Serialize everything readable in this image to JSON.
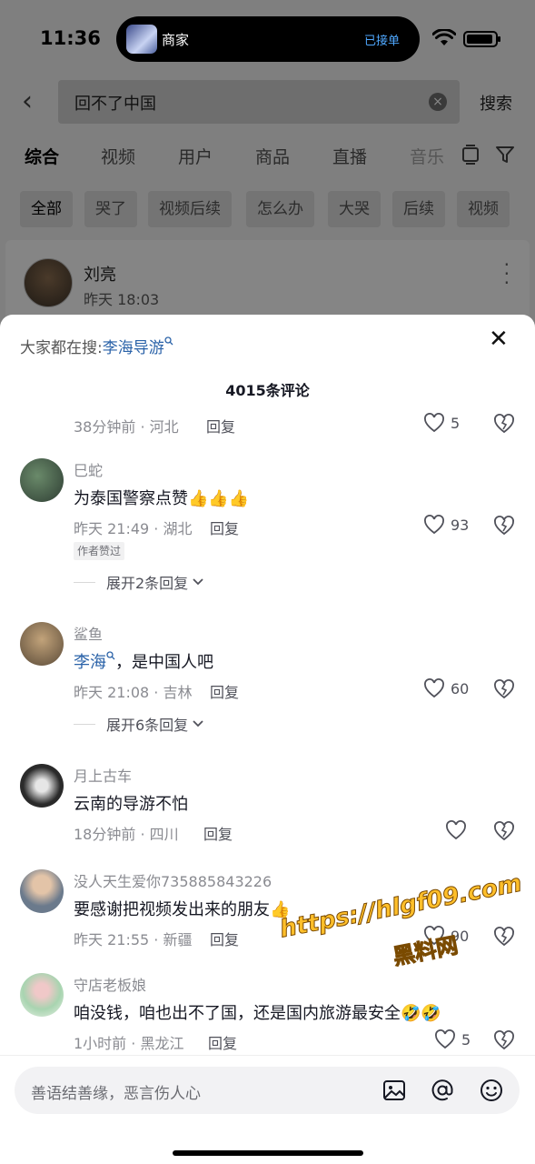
{
  "status_bar": {
    "time": "11:36",
    "island_title": "商家",
    "island_status": "已接单"
  },
  "search": {
    "query": "回不了中国",
    "submit_label": "搜索"
  },
  "tabs": [
    "综合",
    "视频",
    "用户",
    "商品",
    "直播",
    "音乐"
  ],
  "chips": [
    "全部",
    "哭了",
    "视频后续",
    "怎么办",
    "大哭",
    "后续",
    "视频"
  ],
  "result_card": {
    "name": "刘亮",
    "time": "昨天 18:03"
  },
  "sheet": {
    "hot_prefix": "大家都在搜:",
    "hot_term": "李海导游",
    "title": "4015条评论"
  },
  "comments": [
    {
      "user": "",
      "text": "",
      "meta": "38分钟前 · 河北",
      "reply": "回复",
      "likes": "5"
    },
    {
      "user": "巳蛇",
      "text": "为泰国警察点赞",
      "meta": "昨天 21:49 · 湖北",
      "reply": "回复",
      "likes": "93",
      "badge": "作者赞过",
      "expand": "展开2条回复"
    },
    {
      "user": "鲨鱼",
      "mention": "李海",
      "text": "，是中国人吧",
      "meta": "昨天 21:08 · 吉林",
      "reply": "回复",
      "likes": "60",
      "expand": "展开6条回复"
    },
    {
      "user": "月上古车",
      "text": "云南的导游不怕",
      "meta": "18分钟前 · 四川",
      "reply": "回复",
      "likes": ""
    },
    {
      "user": "没人天生爱你735885843226",
      "text": "要感谢把视频发出来的朋友",
      "meta": "昨天 21:55 · 新疆",
      "reply": "回复",
      "likes": "90"
    },
    {
      "user": "守店老板娘",
      "text": "咱没钱，咱也出不了国，还是国内旅游最安全",
      "meta": "1小时前 · 黑龙江",
      "reply": "回复",
      "likes": "5"
    }
  ],
  "input": {
    "placeholder": "善语结善缘，恶言伤人心"
  },
  "watermark": {
    "url": "https://hlgf09.com",
    "name": "黑料网"
  }
}
